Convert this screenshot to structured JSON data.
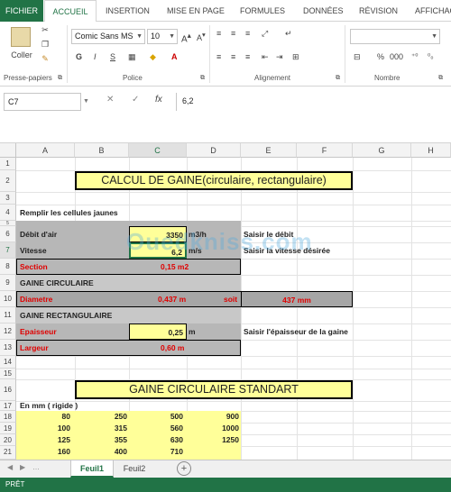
{
  "tabs": [
    "FICHIER",
    "ACCUEIL",
    "INSERTION",
    "MISE EN PAGE",
    "FORMULES",
    "DONNÉES",
    "RÉVISION",
    "AFFICHAGE"
  ],
  "ribbon": {
    "paste_label": "Coller",
    "font_name": "Comic Sans MS",
    "font_size": "10",
    "bold": "G",
    "italic": "I",
    "underline": "S",
    "percent": "%",
    "thousands": "000",
    "currency_label": "",
    "groups": [
      "Presse-papiers",
      "Police",
      "Alignement",
      "Nombre"
    ]
  },
  "formula_bar": {
    "cell_ref": "C7",
    "cancel": "✕",
    "enter": "✓",
    "fx": "fx",
    "content": "6,2"
  },
  "columns": [
    "A",
    "B",
    "C",
    "D",
    "E",
    "F",
    "G",
    "H"
  ],
  "rows": [
    "1",
    "2",
    "3",
    "4",
    "5",
    "6",
    "7",
    "8",
    "9",
    "10",
    "11",
    "12",
    "13",
    "14",
    "15",
    "16",
    "17",
    "18",
    "19",
    "20",
    "21"
  ],
  "sheet": {
    "title1": "CALCUL DE GAINE(circulaire, rectangulaire)",
    "instruction": "Remplir les cellules jaunes",
    "debit_label": "Débit d'air",
    "debit_value": "3350",
    "debit_unit": "m3/h",
    "debit_hint": "Saisir le débit",
    "vitesse_label": "Vitesse",
    "vitesse_value": "6,2",
    "vitesse_unit": "m/s",
    "vitesse_hint": "Saisir la vitesse désirée",
    "section_label": "Section",
    "section_value": "0,15 m2",
    "gaine_circ": "GAINE CIRCULAIRE",
    "diametre_label": "Diametre",
    "diametre_value": "0,437 m",
    "soit": "soit",
    "diametre_mm": "437 mm",
    "gaine_rect": "GAINE RECTANGULAIRE",
    "epaisseur_label": "Epaisseur",
    "epaisseur_value": "0,25",
    "epaisseur_unit": "m",
    "epaisseur_hint": "Saisir l'épaisseur de la gaine",
    "largeur_label": "Largeur",
    "largeur_value": "0,60 m",
    "title2": "GAINE CIRCULAIRE STANDART",
    "mm_label": "En mm ( rigide )",
    "std_rows": [
      [
        "80",
        "250",
        "500",
        "900"
      ],
      [
        "100",
        "315",
        "560",
        "1000"
      ],
      [
        "125",
        "355",
        "630",
        "1250"
      ],
      [
        "160",
        "400",
        "710",
        ""
      ]
    ],
    "watermark": "Ouedkniss.com"
  },
  "sheet_tabs": [
    "Feuil1",
    "Feuil2"
  ],
  "add_sheet": "+",
  "status": "PRÊT"
}
